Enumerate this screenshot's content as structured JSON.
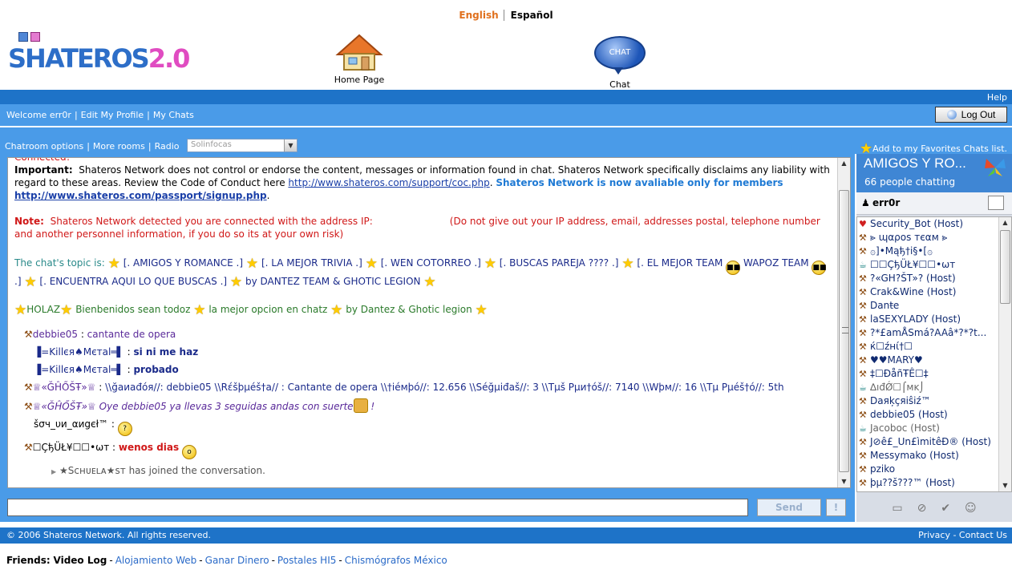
{
  "lang": {
    "english": "English",
    "espanol": "Español"
  },
  "nav": {
    "home": "Home Page",
    "chat": "Chat",
    "chat_bubble": "CHAT"
  },
  "logo": {
    "main": "SHATEROS",
    "version": "2.0"
  },
  "help": "Help",
  "welcome": {
    "greeting": "Welcome err0r",
    "edit_profile": "Edit My Profile",
    "my_chats": "My Chats",
    "sep": "|"
  },
  "logout": "Log Out",
  "options": {
    "chatroom_options": "Chatroom options",
    "more_rooms": "More rooms",
    "radio": "Radio",
    "radio_value": "Solinfocas",
    "favorite": "Add to my Favorites Chats list."
  },
  "chat": {
    "connected": "Connected!",
    "important_label": "Important:",
    "important_text": "Shateros Network does not control or endorse the content, messages or information found in chat. Shateros Network specifically disclaims any liability with regard to these areas. Review the Code of Conduct here",
    "coc_link": "http://www.shateros.com/support/coc.php",
    "members_text": "Shateros Network is now avaliable only for members",
    "signup_link": "http://www.shateros.com/passport/signup.php",
    "note_label": "Note:",
    "note_text": "Shateros Network detected you are connected with the address IP:",
    "note_warning": "(Do not give out your IP address, email, addresses postal, telephone number and another personnel information, if you do so its at your own risk)",
    "topic_label": "The chat's topic is:",
    "topic_parts": [
      "[. AMIGOS Y ROMANCE .]",
      "[. LA MEJOR TRIVIA .]",
      "[. WEN COTORREO .]",
      "[. BUSCAS PAREJA ???? .]",
      "[. EL MEJOR TEAM",
      "WAPOZ TEAM",
      ".]",
      "[. ENCUENTRA AQUI LO QUE BUSCAS .]",
      "by DANTEZ TEAM & GHOTIC LEGION"
    ],
    "welcome_parts": [
      "HOLAZ",
      "Bienbenidos sean todoz",
      "la mejor opcion en chatz",
      "by Dantez & Ghotic legion"
    ],
    "messages": [
      {
        "user": "debbie05",
        "text": "cantante de opera"
      },
      {
        "user": "▐=Killєя♠Mєтal═▌",
        "text": "si ni me haz"
      },
      {
        "user": "▐=Killєя♠Mєтal═▌",
        "text": "probado"
      },
      {
        "user": "♕«ĞĤŐŠŦ»♕",
        "text": "\\\\ğaиađóя//: debbie05 \\\\Rέšþµéš†a// : Cantante de opera \\\\†iéмþó//: 12.656 \\\\Séğµiđaš//: 3 \\\\Tµš Ρµи†óš//: 7140 \\\\Wþм//: 16 \\\\Tµ Ρµéš†ó//: 5th"
      },
      {
        "user": "♕«ĞĤŐŠŦ»♕",
        "text": "Oye debbie05 ya llevas 3 seguidas andas con suerte"
      },
      {
        "user": "šσч_υи_αиgєł™",
        "text": ""
      },
      {
        "user": "☐ÇђÜŁ¥☐☐•ωт",
        "text": "wenos dias"
      }
    ],
    "joined": "★Sᴄʜᴜᴇʟᴀ★sᴛ has joined the conversation."
  },
  "input": {
    "value": "",
    "send": "Send",
    "alert": "!"
  },
  "room": {
    "title": "AMIGOS Y RO...",
    "count": "66 people chatting",
    "me": "err0r",
    "users": [
      "Security_Bot (Host)",
      "⪢ ɰαρos тєαм ⪢",
      "۞]•Mąђ†i§•[۞",
      "☐☐ÇђÜŁ¥☐☐•ωт",
      "?«GH?ŠT»? (Host)",
      "Crak&Wine (Host)",
      "Danŧe",
      "laSEXYLADY (Host)",
      "?*£amÅSmá?AAâ*?*?t...",
      "ќ☐źнί†☐",
      "♥♥MARY♥",
      "‡☐ÐåñŦÊ☐‡",
      "∆ıđǾ☐⌠мĸ⌡",
      "Daяķçяiŝiź™",
      "debbie05 (Host)",
      "Jacoboc (Host)",
      "J⊘ê£_Un£ìmitêÐ® (Host)",
      "Messymako (Host)",
      "pziko",
      "þµ??š???™ (Host)"
    ]
  },
  "footer": {
    "copyright": "© 2006 Shateros Network. All rights reserved.",
    "privacy": "Privacy",
    "contact": "Contact Us",
    "friends_label": "Friends:",
    "friends": [
      "Video Log",
      "Alojamiento Web",
      "Ganar Dinero",
      "Postales HI5",
      "Chismógrafos México"
    ]
  }
}
